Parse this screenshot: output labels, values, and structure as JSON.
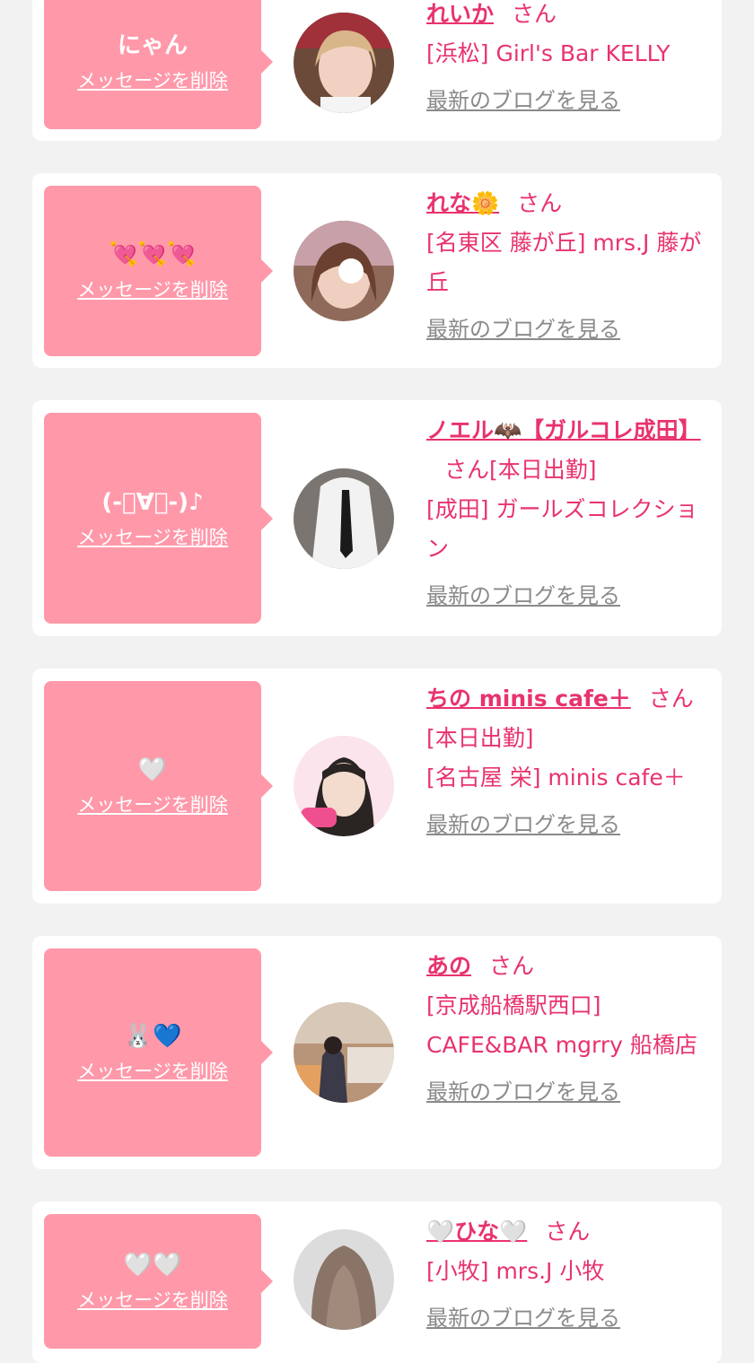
{
  "common": {
    "delete_label": "メッセージを削除",
    "blog_label": "最新のブログを見る",
    "san": "さん"
  },
  "cards": [
    {
      "message": "にゃん",
      "name": "れいか",
      "status": "",
      "shop": "[浜松] Girl's Bar KELLY"
    },
    {
      "message": "💘💘💘",
      "name": "れな🌼",
      "status": "",
      "shop": "[名東区 藤が丘] mrs.J 藤が丘"
    },
    {
      "message": "(-ﾟ∀ﾟ-)♪",
      "name": "ノエル🦇【ガルコレ成田】",
      "status": "[本日出勤]",
      "shop": "[成田] ガールズコレクション"
    },
    {
      "message": "🤍",
      "name": "ちの minis cafe＋",
      "status": "[本日出勤]",
      "shop": "[名古屋 栄] minis cafe＋"
    },
    {
      "message": "🐰💙",
      "name": "あの",
      "status": "",
      "shop": "[京成船橋駅西口] CAFE&BAR mgrry 船橋店"
    },
    {
      "message": "🤍🤍",
      "name": "🤍ひな🤍",
      "status": "",
      "shop": "[小牧] mrs.J 小牧"
    }
  ],
  "colors": {
    "background": "#f2f2f2",
    "bubble": "#ff99aa",
    "accent": "#e8336d",
    "link_gray": "#8a8a8a"
  }
}
